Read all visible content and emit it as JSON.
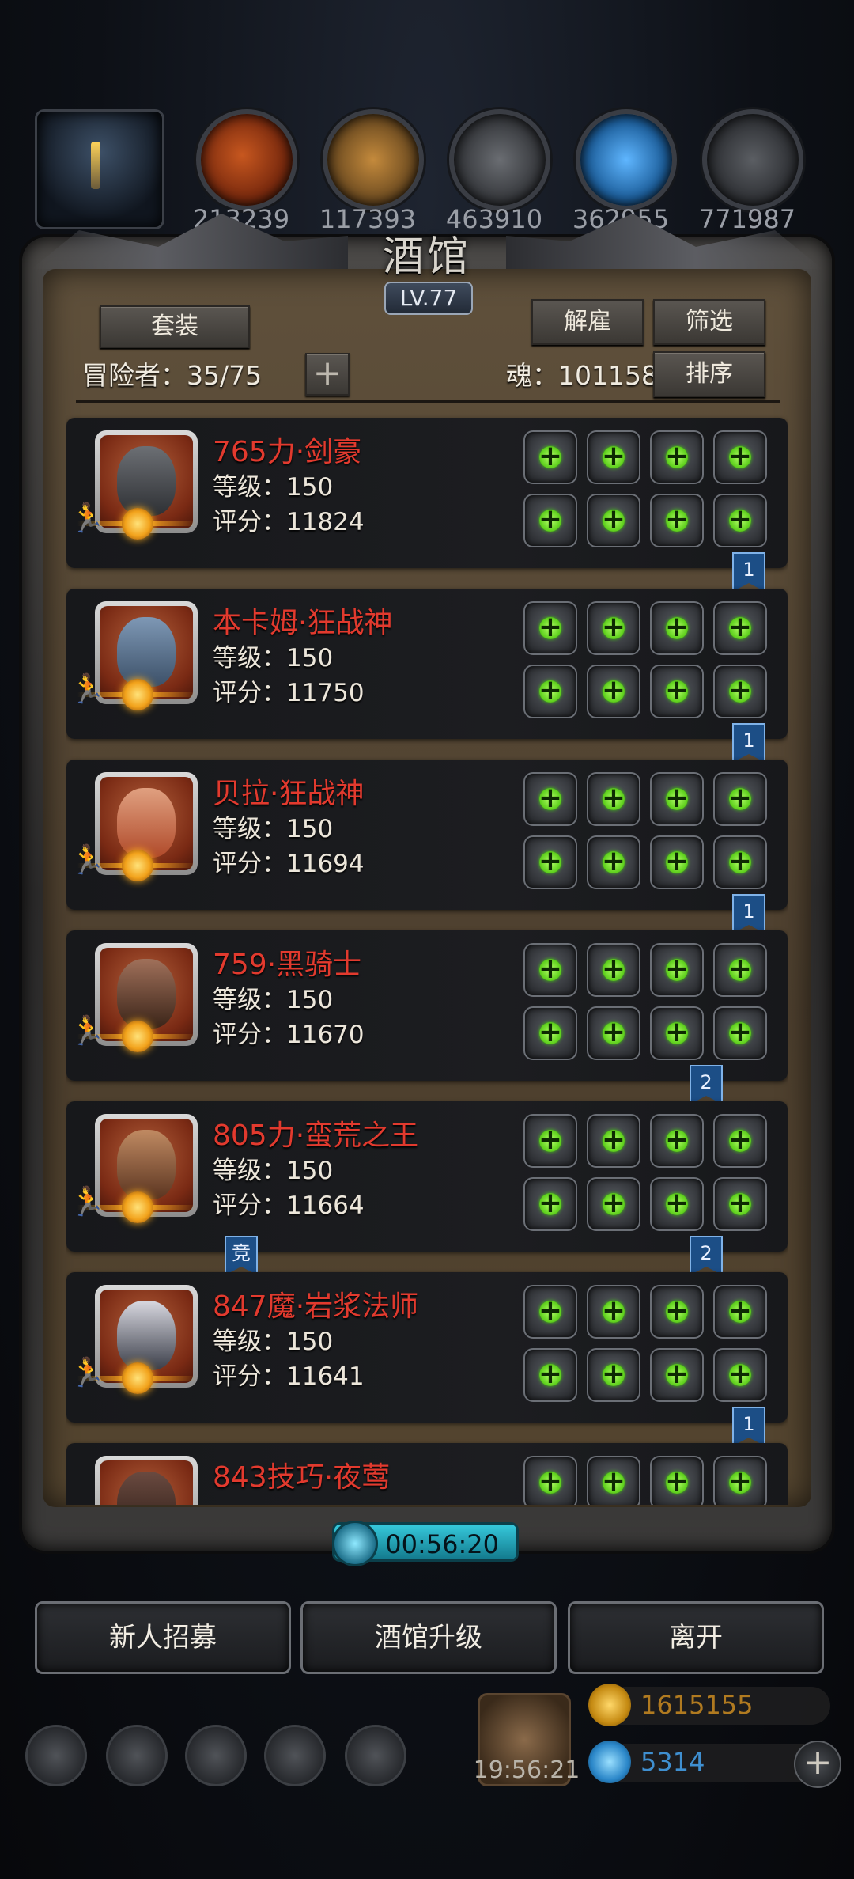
{
  "resources": [
    {
      "icon": "meat-icon",
      "value": "213239"
    },
    {
      "icon": "wood-icon",
      "value": "117393"
    },
    {
      "icon": "iron-icon",
      "value": "463910"
    },
    {
      "icon": "crystal-icon",
      "value": "362955"
    },
    {
      "icon": "ore-icon",
      "value": "771987"
    }
  ],
  "panel": {
    "title": "酒馆",
    "level": "LV.77",
    "buttons": {
      "set": "套装",
      "dismiss": "解雇",
      "filter": "筛选",
      "sort": "排序"
    },
    "adventurers_label": "冒险者：35/75",
    "soul_label": "魂：101158"
  },
  "heroes": [
    {
      "name": "765力·剑豪",
      "level": "等级：150",
      "score": "评分：11824",
      "ribbon": "1"
    },
    {
      "name": "本卡姆·狂战神",
      "level": "等级：150",
      "score": "评分：11750",
      "ribbon": "1"
    },
    {
      "name": "贝拉·狂战神",
      "level": "等级：150",
      "score": "评分：11694",
      "ribbon": "1"
    },
    {
      "name": "759·黑骑士",
      "level": "等级：150",
      "score": "评分：11670",
      "ribbon": "2"
    },
    {
      "name": "805力·蛮荒之王",
      "level": "等级：150",
      "score": "评分：11664",
      "ribbon": "2",
      "arena_tag": "竞"
    },
    {
      "name": "847魔·岩浆法师",
      "level": "等级：150",
      "score": "评分：11641",
      "ribbon": "1"
    },
    {
      "name": "843技巧·夜莺",
      "level": "",
      "score": ""
    }
  ],
  "timer": "00:56:20",
  "actions": {
    "recruit": "新人招募",
    "upgrade": "酒馆升级",
    "leave": "离开"
  },
  "footer": {
    "gift_timer": "19:56:21",
    "gold": "1615155",
    "gems": "5314"
  },
  "colors": {
    "hero_name": "#e23a2e",
    "equip_plus": "#5fd11d",
    "ribbon": "#1c4e86",
    "timer": "#36c9dc"
  }
}
